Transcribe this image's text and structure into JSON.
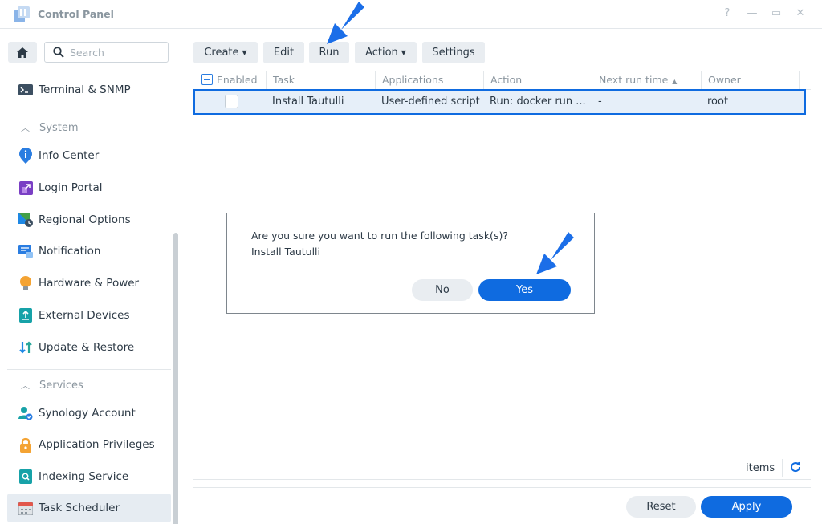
{
  "window": {
    "title": "Control Panel",
    "controls": {
      "help": "?",
      "minimize": "—",
      "maximize": "▭",
      "close": "✕"
    }
  },
  "sidebar": {
    "search_placeholder": "Search",
    "items": [
      {
        "label": "Terminal & SNMP",
        "icon": "terminal-icon"
      },
      {
        "section": "System"
      },
      {
        "label": "Info Center",
        "icon": "info-icon"
      },
      {
        "label": "Login Portal",
        "icon": "login-portal-icon"
      },
      {
        "label": "Regional Options",
        "icon": "regional-options-icon"
      },
      {
        "label": "Notification",
        "icon": "notification-icon"
      },
      {
        "label": "Hardware & Power",
        "icon": "hardware-power-icon"
      },
      {
        "label": "External Devices",
        "icon": "external-devices-icon"
      },
      {
        "label": "Update & Restore",
        "icon": "update-restore-icon"
      },
      {
        "section": "Services"
      },
      {
        "label": "Synology Account",
        "icon": "account-icon"
      },
      {
        "label": "Application Privileges",
        "icon": "privileges-icon"
      },
      {
        "label": "Indexing Service",
        "icon": "indexing-icon"
      },
      {
        "label": "Task Scheduler",
        "icon": "calendar-icon",
        "active": true
      }
    ]
  },
  "toolbar": {
    "create": "Create",
    "edit": "Edit",
    "run": "Run",
    "action": "Action",
    "settings": "Settings"
  },
  "table": {
    "columns": [
      "Enabled",
      "Task",
      "Applications",
      "Action",
      "Next run time",
      "Owner"
    ],
    "rows": [
      {
        "enabled": false,
        "task": "Install Tautulli",
        "applications": "User-defined script",
        "action": "Run: docker run ...",
        "next_run_time": "-",
        "owner": "root"
      }
    ]
  },
  "dialog": {
    "message": "Are you sure you want to run the following task(s)?",
    "task": "Install Tautulli",
    "no": "No",
    "yes": "Yes"
  },
  "footer": {
    "items_label": "items",
    "reset": "Reset",
    "apply": "Apply"
  },
  "colors": {
    "accent": "#0f6be0",
    "arrow": "#1b6ee8",
    "selected_row": "#e6eff9"
  }
}
